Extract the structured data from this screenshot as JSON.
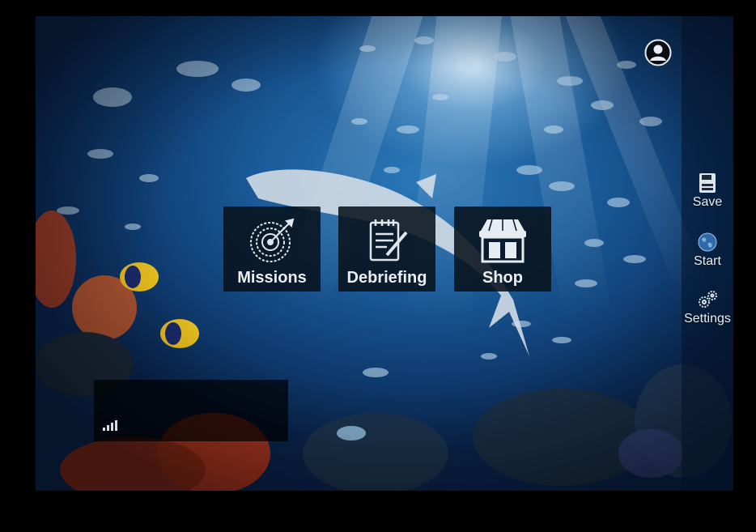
{
  "menu": {
    "tiles": [
      {
        "label": "Missions",
        "icon": "target-icon"
      },
      {
        "label": "Debriefing",
        "icon": "notepad-pencil-icon"
      },
      {
        "label": "Shop",
        "icon": "storefront-icon"
      }
    ]
  },
  "sidebar": {
    "avatar_icon": "user-avatar-icon",
    "items": [
      {
        "label": "Save",
        "icon": "floppy-disk-icon"
      },
      {
        "label": "Start",
        "icon": "globe-icon"
      },
      {
        "label": "Settings",
        "icon": "gears-icon"
      }
    ]
  },
  "status_panel": {
    "icon": "signal-strength-icon"
  },
  "colors": {
    "tile_bg": "#08121c",
    "text": "#e9eef3",
    "water_light": "#2a78b8",
    "water_dark": "#0a2650"
  }
}
